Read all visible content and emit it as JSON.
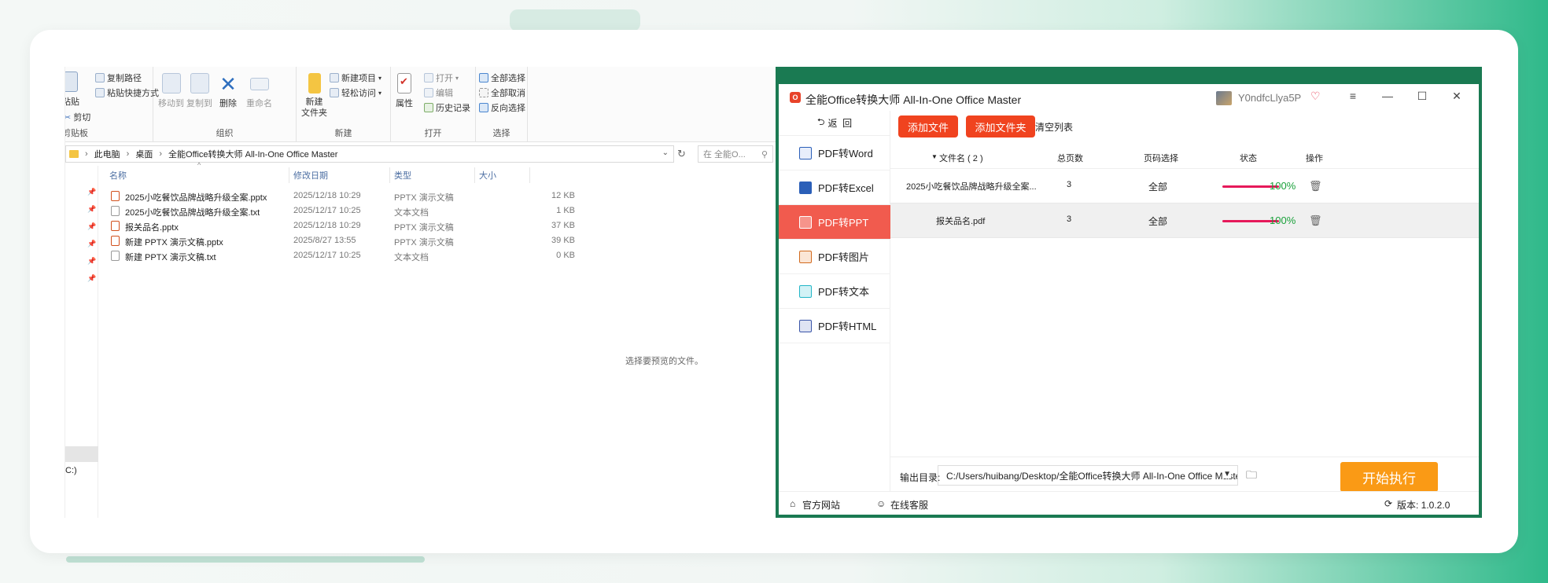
{
  "explorer": {
    "ribbon": {
      "clipboard": {
        "paste_label": "粘贴",
        "copy_path_label": "复制路径",
        "paste_shortcut_label": "粘贴快捷方式",
        "cut_label": "剪切",
        "group_label": "剪贴板"
      },
      "organize": {
        "move_to_label": "移动到",
        "copy_to_label": "复制到",
        "delete_label": "删除",
        "rename_label": "重命名",
        "group_label": "组织"
      },
      "new": {
        "new_folder_label": "新建\n文件夹",
        "new_item_label": "新建项目",
        "easy_access_label": "轻松访问",
        "group_label": "新建"
      },
      "open": {
        "properties_label": "属性",
        "open_label": "打开",
        "edit_label": "编辑",
        "history_label": "历史记录",
        "group_label": "打开"
      },
      "select": {
        "select_all_label": "全部选择",
        "select_none_label": "全部取消",
        "invert_label": "反向选择",
        "group_label": "选择"
      }
    },
    "address": {
      "crumbs": [
        "此电脑",
        "桌面",
        "全能Office转换大师 All-In-One Office Master"
      ],
      "search_placeholder": "在 全能O..."
    },
    "columns": {
      "name": "名称",
      "date": "修改日期",
      "type": "类型",
      "size": "大小"
    },
    "files": [
      {
        "name": "2025小吃餐饮品牌战略升级全案.pptx",
        "date": "2025/12/18 10:29",
        "type": "PPTX 演示文稿",
        "size": "12 KB",
        "icon": "pptx"
      },
      {
        "name": "2025小吃餐饮品牌战略升级全案.txt",
        "date": "2025/12/17 10:25",
        "type": "文本文档",
        "size": "1 KB",
        "icon": "txt"
      },
      {
        "name": "报关品名.pptx",
        "date": "2025/12/18 10:29",
        "type": "PPTX 演示文稿",
        "size": "37 KB",
        "icon": "pptx"
      },
      {
        "name": "新建 PPTX 演示文稿.pptx",
        "date": "2025/8/27 13:55",
        "type": "PPTX 演示文稿",
        "size": "39 KB",
        "icon": "pptx"
      },
      {
        "name": "新建 PPTX 演示文稿.txt",
        "date": "2025/12/17 10:25",
        "type": "文本文档",
        "size": "0 KB",
        "icon": "txt"
      }
    ],
    "preview_text": "选择要预览的文件。",
    "nav_drive": "C:)"
  },
  "app": {
    "title": "全能Office转换大师 All-In-One Office Master",
    "username": "Y0ndfcLlya5P",
    "back_label": "返  回",
    "sidebar": [
      {
        "label": "PDF转Word",
        "icon": "word-icon",
        "color": "#2b5fb8",
        "active": false
      },
      {
        "label": "PDF转Excel",
        "icon": "excel-icon",
        "color": "#1f7d45",
        "active": false
      },
      {
        "label": "PDF转PPT",
        "icon": "ppt-icon",
        "color": "#ffffff",
        "active": true
      },
      {
        "label": "PDF转图片",
        "icon": "image-icon",
        "color": "#d26a1e",
        "active": false
      },
      {
        "label": "PDF转文本",
        "icon": "text-icon",
        "color": "#23b6c7",
        "active": false
      },
      {
        "label": "PDF转HTML",
        "icon": "html-icon",
        "color": "#3a55a8",
        "active": false
      }
    ],
    "toolbar": {
      "add_file": "添加文件",
      "add_folder": "添加文件夹",
      "clear_list": "清空列表"
    },
    "table": {
      "headers": {
        "filename": "文件名 ( 2 )",
        "pages": "总页数",
        "page_select": "页码选择",
        "status": "状态",
        "action": "操作"
      },
      "rows": [
        {
          "filename": "2025小吃餐饮品牌战略升级全案...",
          "pages": "3",
          "page_select": "全部",
          "progress": 1.0,
          "status": "100%"
        },
        {
          "filename": "报关品名.pdf",
          "pages": "3",
          "page_select": "全部",
          "progress": 1.0,
          "status": "100%"
        }
      ]
    },
    "output": {
      "label": "输出目录:",
      "path": "C:/Users/huibang/Desktop/全能Office转换大师 All-In-One Office Master"
    },
    "start_button": "开始执行",
    "footer": {
      "website": "官方网站",
      "support": "在线客服",
      "version": "版本: 1.0.2.0"
    },
    "colors": {
      "accent_red": "#f0431f",
      "active_sidebar": "#f15b4e",
      "start_orange": "#fa9a15",
      "frame_green": "#1a7a52",
      "progress_pink": "#e6195a",
      "status_green": "#1aa13b"
    }
  }
}
